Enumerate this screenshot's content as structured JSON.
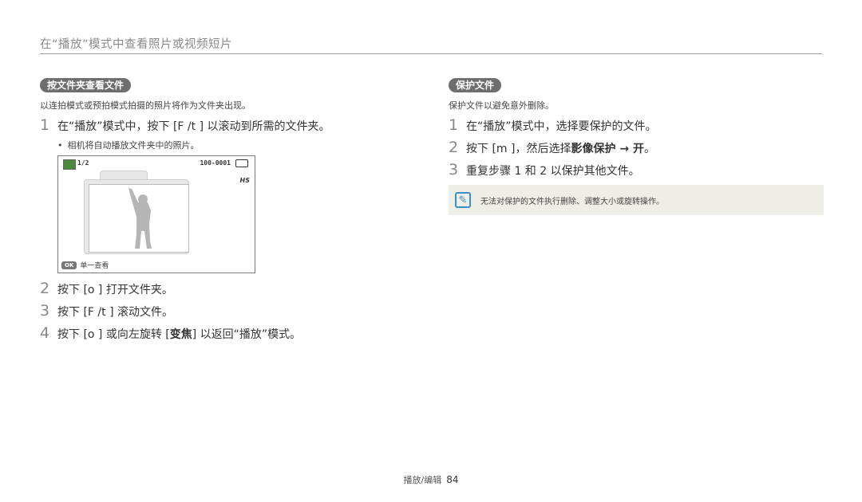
{
  "header": {
    "title": "在“播放”模式中查看照片或视频短片"
  },
  "left": {
    "section_label": "按文件夹查看文件",
    "intro": "以连拍模式或预拍模式拍摄的照片将作为文件夹出现。",
    "steps": [
      {
        "num": "1",
        "text": "在“播放”模式中，按下 [F /t ] 以滚动到所需的文件夹。"
      },
      {
        "num": "2",
        "text": "按下 [o ] 打开文件夹。"
      },
      {
        "num": "3",
        "text": "按下 [F /t ] 滚动文件。"
      },
      {
        "num": "4",
        "pre": "按下 [o ] 或向左旋转 [",
        "bold": "变焦",
        "post": "] 以返回“播放”模式。"
      }
    ],
    "bullet": "相机将自动播放文件夹中的照片。",
    "screen": {
      "count": "1/2",
      "file": "100-0001",
      "hs": "HS",
      "ok_key": "OK",
      "ok_label": "单一查看"
    }
  },
  "right": {
    "section_label": "保护文件",
    "intro": "保护文件以避免意外删除。",
    "steps": [
      {
        "num": "1",
        "text": "在“播放”模式中，选择要保护的文件。"
      },
      {
        "num": "2",
        "pre": "按下 [m ]，然后选择",
        "bold": "影像保护 → 开",
        "post": "。"
      },
      {
        "num": "3",
        "text": "重复步骤 1 和 2 以保护其他文件。"
      }
    ],
    "note": "无法对保护的文件执行删除、调整大小或旋转操作。"
  },
  "footer": {
    "section": "播放/编辑",
    "page": "84"
  },
  "colors": {
    "pill": "#6e6e6e",
    "note_bg": "#efede8",
    "note_icon": "#3a90c8"
  }
}
